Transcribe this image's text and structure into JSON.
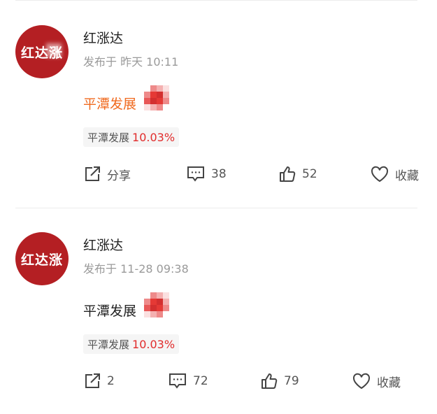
{
  "posts": [
    {
      "avatar_text": "红达涨",
      "author": "红涨达",
      "meta": "发布于 昨天 10:11",
      "title": "平潭发展",
      "title_color": "#f06a1f",
      "stock_name": "平潭发展",
      "stock_change": "10.03%",
      "share": "分享",
      "comments": "38",
      "likes": "52",
      "favorite": "收藏"
    },
    {
      "avatar_text": "红达涨",
      "author": "红涨达",
      "meta": "发布于 11-28 09:38",
      "title": "平潭发展",
      "title_color": "#222222",
      "stock_name": "平潭发展",
      "stock_change": "10.03%",
      "share": "2",
      "comments": "72",
      "likes": "79",
      "favorite": "收藏"
    }
  ],
  "colors": {
    "avatar_bg": "#b41f23",
    "up_red": "#e12c2c",
    "mosaic_red": "#e53935"
  },
  "icons": [
    "share-icon",
    "comment-icon",
    "like-icon",
    "favorite-icon"
  ]
}
